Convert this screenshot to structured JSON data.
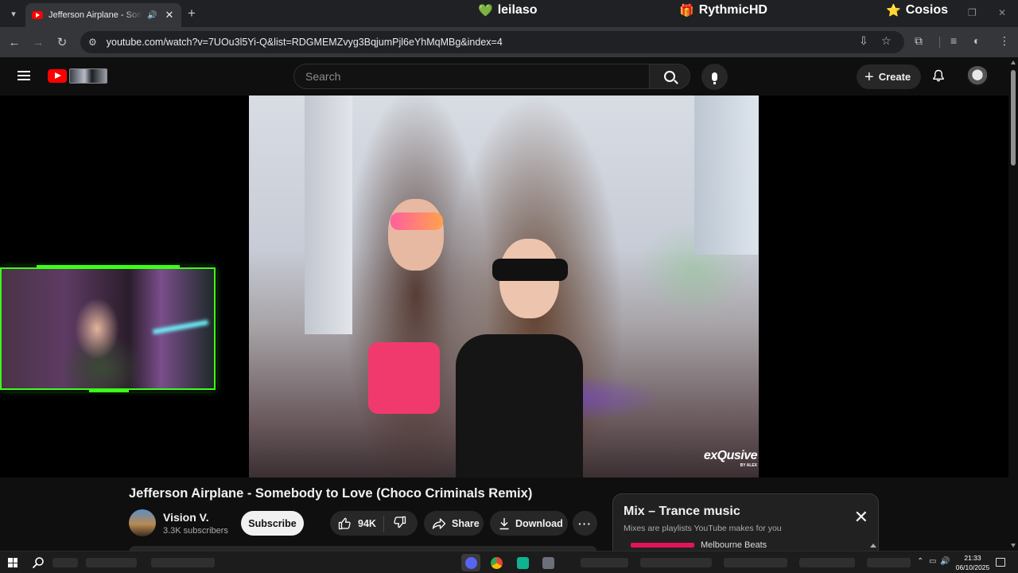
{
  "browser": {
    "tab_title": "Jefferson Airplane - Somebody to Love (Choco Criminals Remix) - YouTube",
    "new_tab": "+",
    "url": "youtube.com/watch?v=7UOu3l5Yi-Q&list=RDGMEMZvyg3BqjumPjl6eYhMqMBg&index=4",
    "tab_close": "✕"
  },
  "stream_overlay": {
    "tag1": {
      "icon": "💚",
      "label": "leilaso"
    },
    "tag2": {
      "icon": "🎁",
      "label": "RythmicHD"
    },
    "tag3": {
      "icon": "⭐",
      "label": "Cosios"
    }
  },
  "youtube": {
    "search_placeholder": "Search",
    "create_label": "Create",
    "video": {
      "title": "Jefferson Airplane - Somebody to Love (Choco Criminals Remix)",
      "watermark": "exQusive",
      "watermark_sub": "BY ALEX"
    },
    "channel": {
      "name": "Vision V.",
      "subscribers": "3.3K subscribers"
    },
    "actions": {
      "subscribe": "Subscribe",
      "likes": "94K",
      "share": "Share",
      "download": "Download",
      "more": "···"
    },
    "mix": {
      "title": "Mix – Trance music",
      "subtitle": "Mixes are playlists YouTube makes for you",
      "first_item": "Melbourne Beats"
    }
  },
  "taskbar": {
    "time": "21:33",
    "date": "06/10/2025"
  },
  "colors": {
    "youtube_red": "#ff0000",
    "overlay_green": "#3bff19",
    "bg": "#0f0f0f"
  }
}
